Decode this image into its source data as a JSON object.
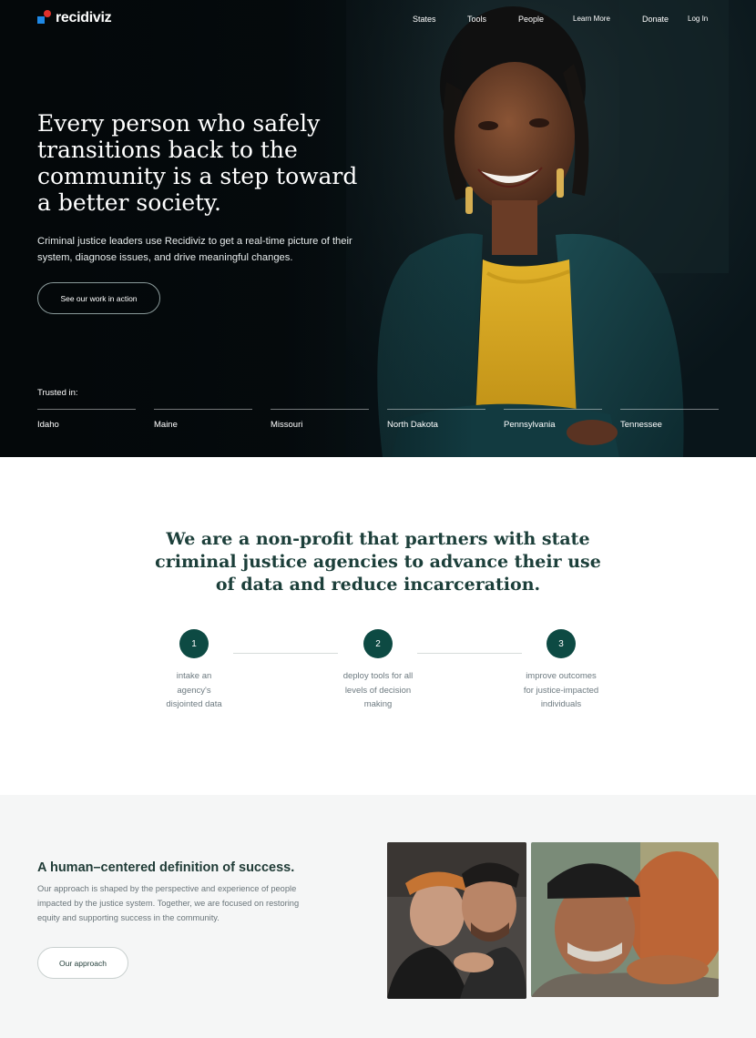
{
  "brand": {
    "name": "recidiviz",
    "blue": "#1e88e5",
    "red": "#e0312b",
    "accent": "#0d4a43"
  },
  "nav": {
    "items": [
      "States",
      "Tools",
      "People",
      "Learn More",
      "Donate",
      "Log In"
    ]
  },
  "hero": {
    "title": "Every person who safely transitions back to the community is a step toward a better society.",
    "subtitle": "Criminal justice leaders use Recidiviz to get a real-time picture of their system, diagnose issues, and drive meaningful changes.",
    "cta_label": "See our work in action",
    "trusted_label": "Trusted in:",
    "states": [
      "Idaho",
      "Maine",
      "Missouri",
      "North Dakota",
      "Pennsylvania",
      "Tennessee"
    ]
  },
  "mission": {
    "title": "We are a non-profit that partners with state criminal justice agencies to advance their use of data and reduce incarceration.",
    "steps": [
      {
        "number": "1",
        "text": "intake an agency's disjointed data"
      },
      {
        "number": "2",
        "text": "deploy tools for all levels of decision making"
      },
      {
        "number": "3",
        "text": "improve outcomes for justice-impacted individuals"
      }
    ]
  },
  "approach": {
    "title": "A human–centered definition of success.",
    "body": "Our approach is shaped by the perspective and experience of people impacted by the justice system. Together, we are focused on restoring equity and supporting success in the community.",
    "cta_label": "Our approach"
  }
}
